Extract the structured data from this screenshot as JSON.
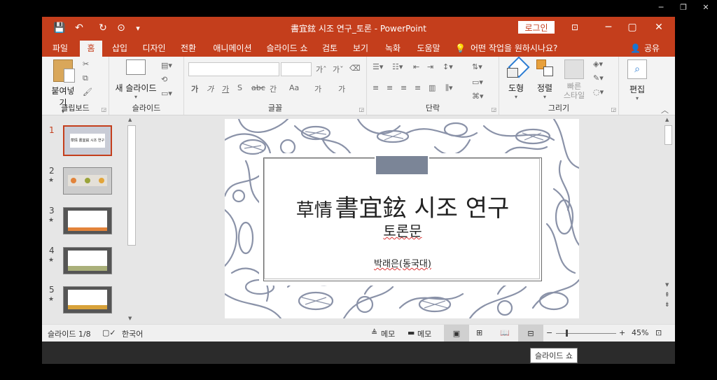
{
  "window": {
    "title": "書宜鉉 시조 연구_토론  -  PowerPoint",
    "login": "로그인",
    "controls": [
      "─",
      "▢",
      "✕"
    ]
  },
  "quick_access": {
    "icons": [
      "save-icon",
      "undo-icon",
      "redo-icon",
      "touch-mode-icon",
      "customize-icon"
    ],
    "glyphs": [
      "💾",
      "↶",
      "↻",
      "⊙",
      "▾"
    ]
  },
  "tabs": [
    "파일",
    "홈",
    "삽입",
    "디자인",
    "전환",
    "애니메이션",
    "슬라이드 쇼",
    "검토",
    "보기",
    "녹화",
    "도움말"
  ],
  "tell_me": "어떤 작업을 원하시나요?",
  "share": "공유",
  "ribbon": {
    "clipboard": {
      "label": "클립보드",
      "paste": "붙여넣기"
    },
    "slides": {
      "label": "슬라이드",
      "new_slide": "새 슬라이드"
    },
    "font": {
      "label": "글꼴",
      "buttons": [
        "가",
        "가",
        "가",
        "S",
        "abc",
        "간",
        "Aa",
        "가",
        "가"
      ]
    },
    "paragraph": {
      "label": "단락"
    },
    "drawing": {
      "label": "그리기",
      "shapes": "도형",
      "arrange": "정렬",
      "quick_styles": "빠른\n스타일"
    },
    "editing": {
      "label": "편집"
    }
  },
  "slides_pane": {
    "numbers": [
      "1",
      "2",
      "3",
      "4",
      "5"
    ],
    "star": "★",
    "thumb1_title": "草情 書宜鉉 시조 연구"
  },
  "slide": {
    "title": "草情 書宜鉉 시조 연구",
    "title_prefix": "草情",
    "title_main": "書宜鉉 시조 연구",
    "subtitle": "토론문",
    "author": "박래은(동국대)"
  },
  "status": {
    "slide_info": "슬라이드 1/8",
    "language": "한국어",
    "notes": "메모",
    "comments": "메모",
    "zoom": "45%"
  },
  "tooltip": "슬라이드 쇼",
  "colors": {
    "accent": "#c43e1c",
    "ribbon_bg": "#f3f3f3",
    "pattern": "#8a92a8"
  }
}
